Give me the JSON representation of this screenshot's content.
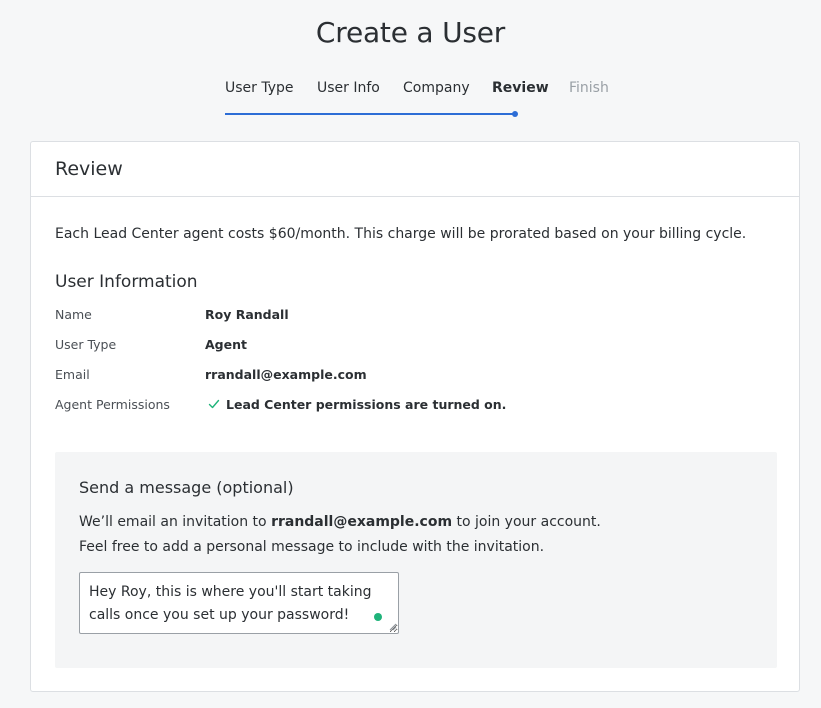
{
  "page": {
    "title": "Create a User"
  },
  "stepper": {
    "steps": [
      {
        "label": "User Type",
        "state": "done"
      },
      {
        "label": "User Info",
        "state": "done"
      },
      {
        "label": "Company",
        "state": "done"
      },
      {
        "label": "Review",
        "state": "active"
      },
      {
        "label": "Finish",
        "state": "disabled"
      }
    ],
    "accent_color": "#2d6dd6"
  },
  "review": {
    "header": "Review",
    "cost_note": "Each Lead Center agent costs $60/month. This charge will be prorated based on your billing cycle.",
    "user_info": {
      "title": "User Information",
      "rows": [
        {
          "label": "Name",
          "value": "Roy Randall"
        },
        {
          "label": "User Type",
          "value": "Agent"
        },
        {
          "label": "Email",
          "value": "rrandall@example.com"
        },
        {
          "label": "Agent Permissions",
          "value": "Lead Center permissions are turned on.",
          "icon": "check-icon"
        }
      ]
    },
    "message": {
      "title": "Send a message (optional)",
      "line1_prefix": "We’ll email an invitation to ",
      "line1_email": "rrandall@example.com",
      "line1_suffix": " to join your account.",
      "line2": "Feel free to add a personal message to include with the invitation.",
      "textarea_value": "Hey Roy, this is where you'll start taking calls once you set up your password!",
      "status_color": "#1fb37a"
    }
  }
}
